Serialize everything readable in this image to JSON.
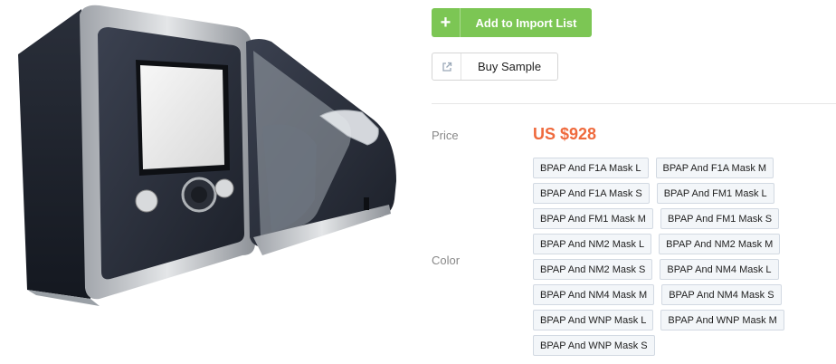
{
  "product": {
    "image_alt": "CPAP machine product photo"
  },
  "actions": {
    "add_to_import": "Add to Import List",
    "add_icon": "plus-icon",
    "buy_sample": "Buy Sample",
    "buy_sample_icon": "external-link-icon"
  },
  "price": {
    "label": "Price",
    "value": "US $928"
  },
  "color": {
    "label": "Color",
    "options": [
      [
        "BPAP And F1A Mask L",
        "BPAP And F1A Mask M"
      ],
      [
        "BPAP And F1A Mask S",
        "BPAP And FM1 Mask L"
      ],
      [
        "BPAP And FM1 Mask M",
        "BPAP And FM1 Mask S"
      ],
      [
        "BPAP And NM2 Mask L",
        "BPAP And NM2 Mask M"
      ],
      [
        "BPAP And NM2 Mask S",
        "BPAP And NM4 Mask L"
      ],
      [
        "BPAP And NM4 Mask M",
        "BPAP And NM4 Mask S"
      ],
      [
        "BPAP And WNP Mask L",
        "BPAP And WNP Mask M"
      ],
      [
        "BPAP And WNP Mask S"
      ]
    ]
  },
  "colors": {
    "accent_green": "#7cc654",
    "price_orange": "#ef6a3d"
  }
}
